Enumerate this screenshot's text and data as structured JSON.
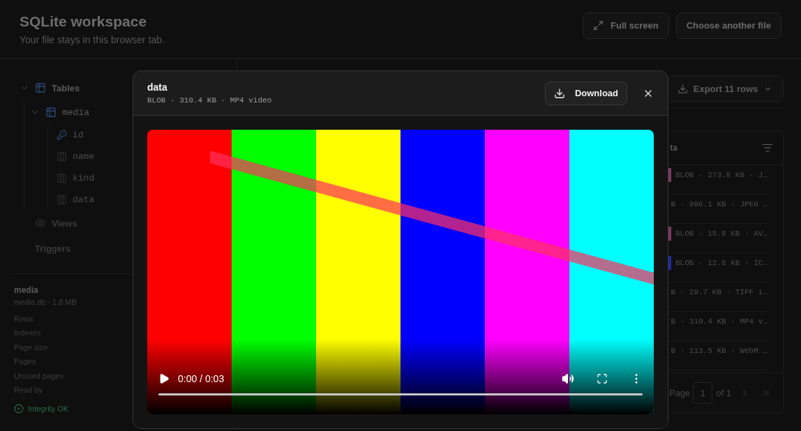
{
  "header": {
    "title": "SQLite workspace",
    "subtitle": "Your file stays in this browser tab.",
    "buttons": [
      {
        "label": "Full screen",
        "kind": "fullscreen"
      },
      {
        "label": "Choose another file",
        "kind": "plain"
      }
    ]
  },
  "tree": [
    {
      "label": "Tables",
      "kind": "group",
      "expanded": true,
      "children": [
        {
          "label": "media",
          "kind": "table",
          "expanded": true,
          "children": [
            {
              "label": "id",
              "kind": "key"
            },
            {
              "label": "name",
              "kind": "column"
            },
            {
              "label": "kind",
              "kind": "column"
            },
            {
              "label": "data",
              "kind": "column"
            }
          ]
        }
      ]
    },
    {
      "label": "Views",
      "kind": "views"
    },
    {
      "label": "Triggers",
      "kind": "triggers"
    }
  ],
  "database": {
    "name": "media",
    "file": "media.db · 1.8 MB",
    "stats": [
      "Rows",
      "Indexes",
      "Page size",
      "Pages",
      "Unused pages",
      "Read by"
    ],
    "integrity": "Integrity OK"
  },
  "export_button": "Export 11 rows",
  "table": {
    "column": "ta",
    "rows": [
      {
        "text": "BLOB · 273.8 KB · J…",
        "color": "#7a3a5e"
      },
      {
        "text": "B · 996.1 KB · JPEG …"
      },
      {
        "text": "BLOB · 15.8 KB · AV…",
        "color": "#7a3a5e"
      },
      {
        "text": "BLOB · 12.6 KB · IC…",
        "color": "#1f2aa0"
      },
      {
        "text": "B · 29.7 KB · TIFF i…"
      },
      {
        "text": "B · 310.4 KB · MP4 v…"
      },
      {
        "text": "B · 113.5 KB · WebM …"
      }
    ]
  },
  "pagination": {
    "label": "Page",
    "page": "1",
    "total": "of 1"
  },
  "modal": {
    "title": "data",
    "meta": "BLOB · 310.4 KB · MP4 video",
    "download": "Download",
    "player": {
      "time": "0:00 / 0:03",
      "progress": {
        "level": 0
      }
    }
  }
}
